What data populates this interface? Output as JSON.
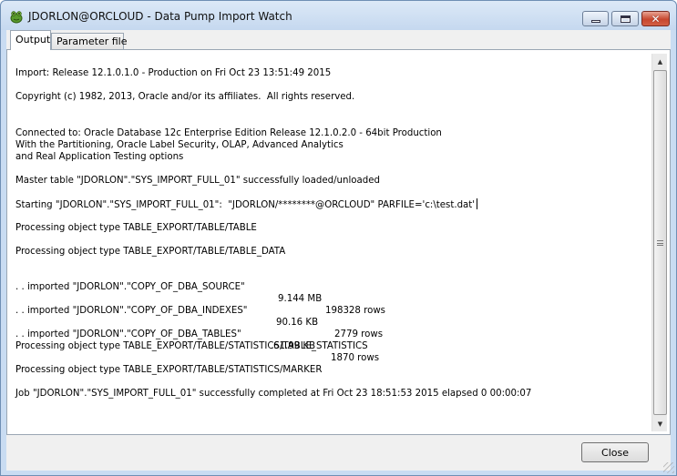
{
  "window": {
    "title": "JDORLON@ORCLOUD - Data Pump Import Watch",
    "minimize_icon": "minimize-icon",
    "maximize_icon": "maximize-icon",
    "close_icon": "close-icon"
  },
  "tabs": [
    {
      "label": "Output",
      "active": true
    },
    {
      "label": "Parameter file",
      "active": false
    }
  ],
  "output": {
    "lines": [
      "Import: Release 12.1.0.1.0 - Production on Fri Oct 23 13:51:49 2015",
      "Copyright (c) 1982, 2013, Oracle and/or its affiliates.  All rights reserved.",
      "Connected to: Oracle Database 12c Enterprise Edition Release 12.1.0.2.0 - 64bit Production",
      "With the Partitioning, Oracle Label Security, OLAP, Advanced Analytics",
      "and Real Application Testing options",
      "Master table \"JDORLON\".\"SYS_IMPORT_FULL_01\" successfully loaded/unloaded",
      "Starting \"JDORLON\".\"SYS_IMPORT_FULL_01\":  \"JDORLON/********@ORCLOUD\" PARFILE='c:\\test.dat'",
      "Processing object type TABLE_EXPORT/TABLE/TABLE",
      "Processing object type TABLE_EXPORT/TABLE/TABLE_DATA",
      "Processing object type TABLE_EXPORT/TABLE/STATISTICS/TABLE_STATISTICS",
      "Processing object type TABLE_EXPORT/TABLE/STATISTICS/MARKER",
      "Job \"JDORLON\".\"SYS_IMPORT_FULL_01\" successfully completed at Fri Oct 23 18:51:53 2015 elapsed 0 00:00:07"
    ],
    "imports": [
      {
        "prefix": ". . imported \"JDORLON\".\"COPY_OF_DBA_SOURCE\"",
        "size": "9.144 MB",
        "rows": "198328 rows"
      },
      {
        "prefix": ". . imported \"JDORLON\".\"COPY_OF_DBA_INDEXES\"",
        "size": "90.16 KB",
        "rows": "2779 rows"
      },
      {
        "prefix": ". . imported \"JDORLON\".\"COPY_OF_DBA_TABLES\"",
        "size": "61.99 KB",
        "rows": "1870 rows"
      }
    ]
  },
  "buttons": {
    "close_label": "Close"
  },
  "colors": {
    "title_bar": "#c9dcf2",
    "close_button_red": "#c7472f"
  }
}
